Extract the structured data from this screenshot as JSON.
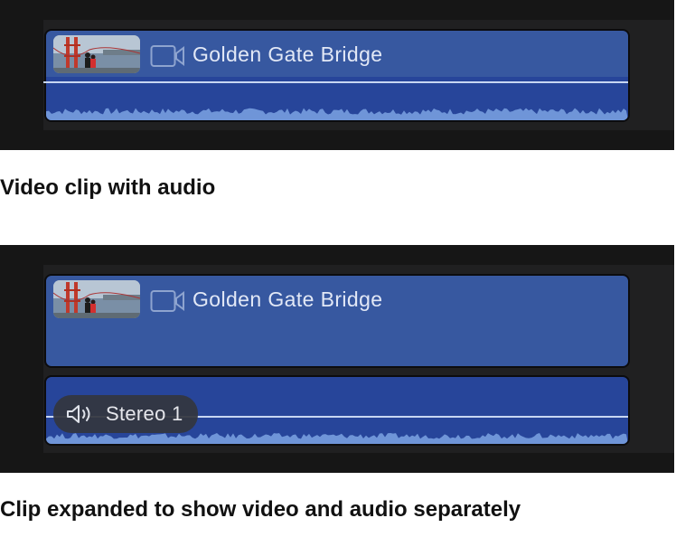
{
  "example1": {
    "clip_title": "Golden Gate Bridge",
    "caption": "Video clip with audio"
  },
  "example2": {
    "clip_title": "Golden Gate Bridge",
    "audio_role": "Stereo 1",
    "caption": "Clip expanded to show video and audio separately"
  },
  "icons": [
    "video-camera-icon",
    "speaker-icon"
  ],
  "colors": {
    "clip_blue": "#3758a0",
    "audio_blue": "#27459a",
    "waveform": "#6f95d8",
    "volume_line": "#c8d6f2",
    "timeline_bg": "#202021"
  }
}
